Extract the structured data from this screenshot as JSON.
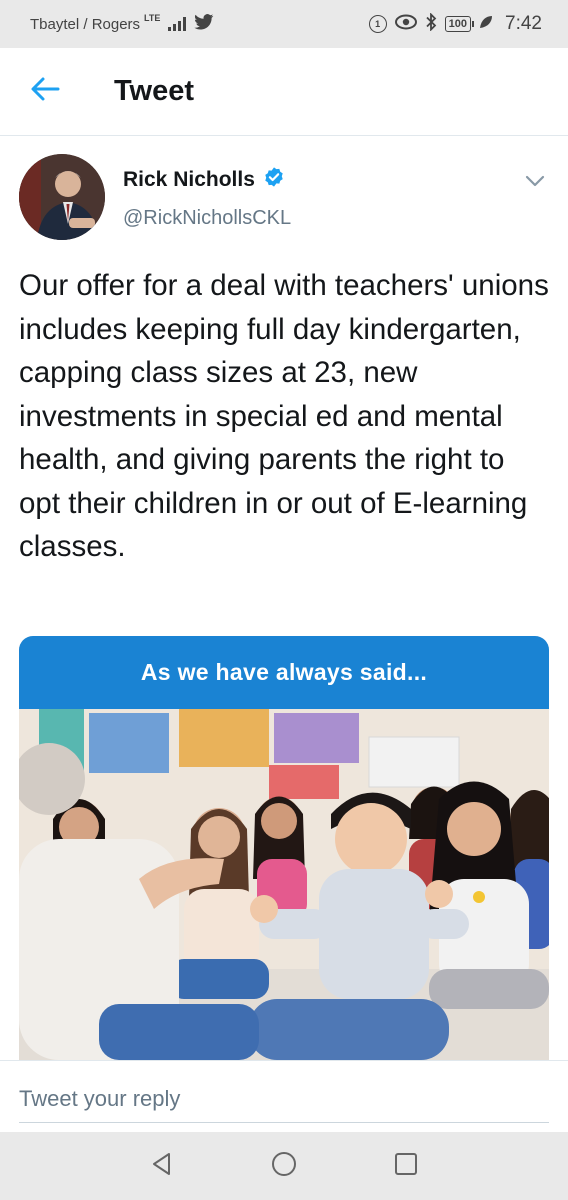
{
  "status_bar": {
    "carrier": "Tbaytel / Rogers",
    "network": "LTE",
    "battery": "100",
    "time": "7:42",
    "icons": [
      "signal-icon",
      "twitter-bird-icon",
      "data-saver-icon",
      "eye-icon",
      "bluetooth-icon",
      "battery-icon",
      "leaf-icon"
    ]
  },
  "header": {
    "title": "Tweet",
    "back_icon": "arrow-left-icon",
    "accent_color": "#1da1f2"
  },
  "tweet": {
    "author_name": "Rick Nicholls",
    "handle": "@RickNichollsCKL",
    "verified": true,
    "text": "Our offer for a deal with teachers' unions includes keeping full day kindergarten, capping class sizes at 23, new investments in special ed and mental health, and giving parents the right to opt their children in or out of E-learning classes.",
    "media": {
      "banner_text": "As we have always said...",
      "banner_color": "#1a83d3"
    }
  },
  "reply": {
    "placeholder": "Tweet your reply"
  },
  "nav": {
    "icons": [
      "back-triangle-icon",
      "home-circle-icon",
      "recents-square-icon"
    ]
  }
}
